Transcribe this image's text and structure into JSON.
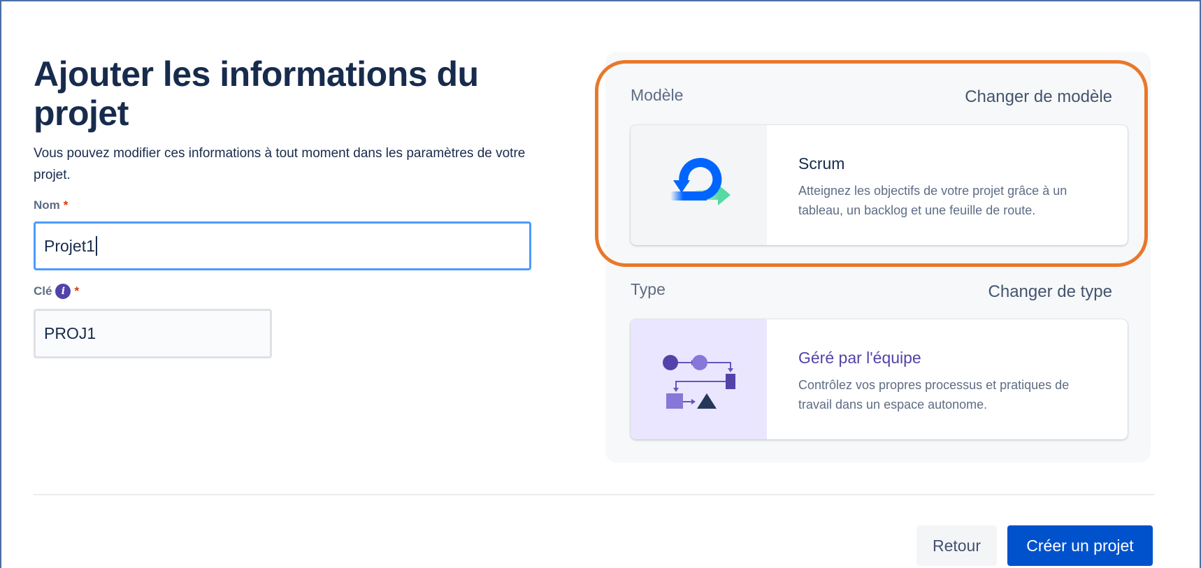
{
  "form": {
    "title": "Ajouter les informations du projet",
    "description": "Vous pouvez modifier ces informations à tout moment dans les paramètres de votre projet.",
    "name_label": "Nom",
    "name_value": "Projet1",
    "key_label": "Clé",
    "key_value": "PROJ1",
    "required_mark": "*",
    "info_glyph": "i"
  },
  "template": {
    "section_label": "Modèle",
    "change_link": "Changer de modèle",
    "card_title": "Scrum",
    "card_description": "Atteignez les objectifs de votre projet grâce à un tableau, un backlog et une feuille de route.",
    "icon": "scrum-icon"
  },
  "type": {
    "section_label": "Type",
    "change_link": "Changer de type",
    "card_title": "Géré par l'équipe",
    "card_description": "Contrôlez vos propres processus et pratiques de travail dans un espace autonome.",
    "icon": "team-managed-icon"
  },
  "footer": {
    "back_label": "Retour",
    "create_label": "Créer un projet"
  },
  "colors": {
    "primary": "#0052cc",
    "highlight": "#e8782a",
    "focus": "#4c9aff",
    "type_accent": "#5243aa"
  }
}
